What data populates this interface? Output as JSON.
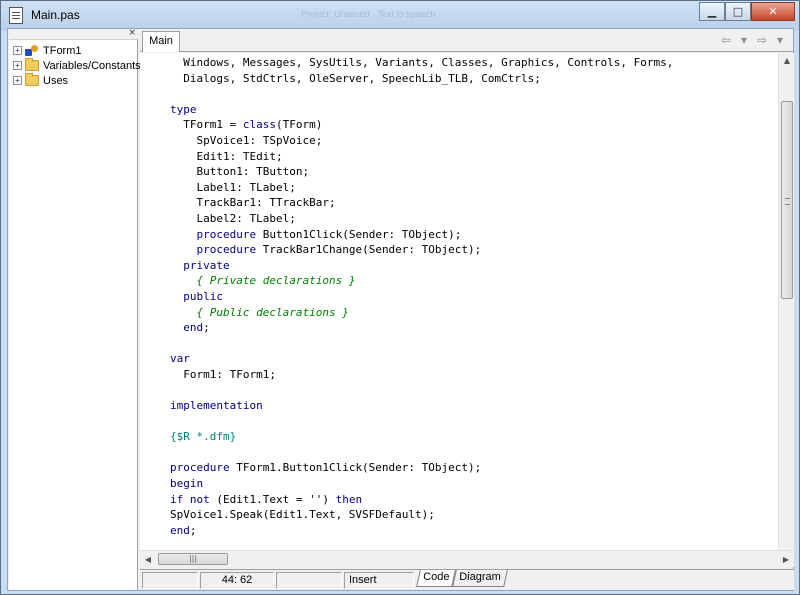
{
  "window": {
    "title": "Main.pas",
    "background_title": "Project: Unsaved · Text to speech"
  },
  "titlebar_buttons": {
    "minimize": "▁",
    "maximize": "□",
    "close": "✕"
  },
  "explorer": {
    "close": "×",
    "items": [
      {
        "label": "TForm1",
        "icon": "class-icon"
      },
      {
        "label": "Variables/Constants",
        "icon": "folder-icon"
      },
      {
        "label": "Uses",
        "icon": "folder-icon"
      }
    ]
  },
  "editor": {
    "tab_label": "Main",
    "nav": {
      "back": "⇦",
      "dropdown": "▾",
      "forward": "⇨",
      "more": "▾"
    }
  },
  "code_lines": [
    [
      {
        "t": "  Windows, Messages, SysUtils, Variants, Classes, Graphics, Controls, Forms,",
        "c": ""
      }
    ],
    [
      {
        "t": "  Dialogs, StdCtrls, OleServer, SpeechLib_TLB, ComCtrls;",
        "c": ""
      }
    ],
    [
      {
        "t": "",
        "c": ""
      }
    ],
    [
      {
        "t": "type",
        "c": "kw"
      }
    ],
    [
      {
        "t": "  TForm1 = ",
        "c": ""
      },
      {
        "t": "class",
        "c": "kw"
      },
      {
        "t": "(TForm)",
        "c": ""
      }
    ],
    [
      {
        "t": "    SpVoice1: TSpVoice;",
        "c": ""
      }
    ],
    [
      {
        "t": "    Edit1: TEdit;",
        "c": ""
      }
    ],
    [
      {
        "t": "    Button1: TButton;",
        "c": ""
      }
    ],
    [
      {
        "t": "    Label1: TLabel;",
        "c": ""
      }
    ],
    [
      {
        "t": "    TrackBar1: TTrackBar;",
        "c": ""
      }
    ],
    [
      {
        "t": "    Label2: TLabel;",
        "c": ""
      }
    ],
    [
      {
        "t": "    ",
        "c": ""
      },
      {
        "t": "procedure",
        "c": "kw"
      },
      {
        "t": " Button1Click(Sender: TObject);",
        "c": ""
      }
    ],
    [
      {
        "t": "    ",
        "c": ""
      },
      {
        "t": "procedure",
        "c": "kw"
      },
      {
        "t": " TrackBar1Change(Sender: TObject);",
        "c": ""
      }
    ],
    [
      {
        "t": "  ",
        "c": ""
      },
      {
        "t": "private",
        "c": "kw"
      }
    ],
    [
      {
        "t": "    ",
        "c": ""
      },
      {
        "t": "{ Private declarations }",
        "c": "cm"
      }
    ],
    [
      {
        "t": "  ",
        "c": ""
      },
      {
        "t": "public",
        "c": "kw"
      }
    ],
    [
      {
        "t": "    ",
        "c": ""
      },
      {
        "t": "{ Public declarations }",
        "c": "cm"
      }
    ],
    [
      {
        "t": "  ",
        "c": ""
      },
      {
        "t": "end",
        "c": "kw"
      },
      {
        "t": ";",
        "c": ""
      }
    ],
    [
      {
        "t": "",
        "c": ""
      }
    ],
    [
      {
        "t": "var",
        "c": "kw"
      }
    ],
    [
      {
        "t": "  Form1: TForm1;",
        "c": ""
      }
    ],
    [
      {
        "t": "",
        "c": ""
      }
    ],
    [
      {
        "t": "implementation",
        "c": "kw"
      }
    ],
    [
      {
        "t": "",
        "c": ""
      }
    ],
    [
      {
        "t": "{$R *.dfm}",
        "c": "dr"
      }
    ],
    [
      {
        "t": "",
        "c": ""
      }
    ],
    [
      {
        "t": "procedure",
        "c": "kw"
      },
      {
        "t": " TForm1.Button1Click(Sender: TObject);",
        "c": ""
      }
    ],
    [
      {
        "t": "begin",
        "c": "kw"
      }
    ],
    [
      {
        "t": "if",
        "c": "kw"
      },
      {
        "t": " ",
        "c": ""
      },
      {
        "t": "not",
        "c": "kw"
      },
      {
        "t": " (Edit1.Text = '') ",
        "c": ""
      },
      {
        "t": "then",
        "c": "kw"
      }
    ],
    [
      {
        "t": "SpVoice1.Speak(Edit1.Text, SVSFDefault);",
        "c": ""
      }
    ],
    [
      {
        "t": "end",
        "c": "kw"
      },
      {
        "t": ";",
        "c": ""
      }
    ]
  ],
  "scrollbars": {
    "up": "▲",
    "down": "▼",
    "left": "◀",
    "right": "▶",
    "grip": "|||"
  },
  "statusbar": {
    "cell1": "",
    "position": "44:  62",
    "cell3": "",
    "mode": "Insert",
    "tabs": [
      "Code",
      "Diagram"
    ]
  },
  "colors": {
    "keyword": "#000080",
    "comment": "#008000",
    "directive": "#008080"
  }
}
